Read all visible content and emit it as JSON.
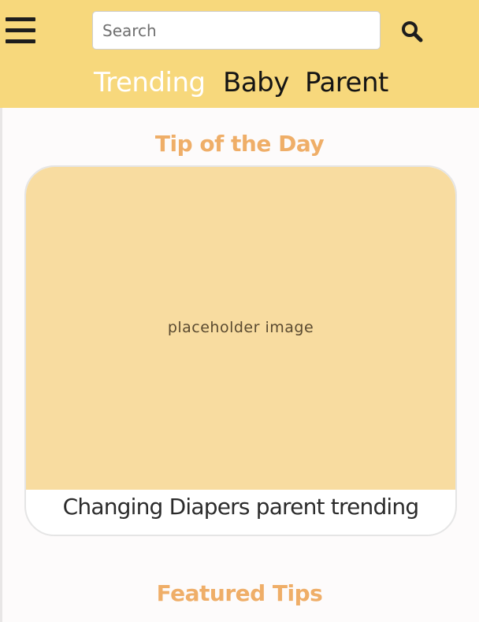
{
  "header": {
    "menu_icon": "hamburger-menu-icon",
    "search": {
      "placeholder": "Search",
      "value": ""
    },
    "search_icon": "magnifying-glass-icon",
    "tabs": [
      {
        "label": "Trending",
        "active": true
      },
      {
        "label": "Baby",
        "active": false
      },
      {
        "label": "Parent",
        "active": false
      }
    ]
  },
  "main": {
    "tip_of_the_day": {
      "title": "Tip of the Day",
      "card": {
        "image_label": "placeholder image",
        "caption": "Changing Diapers parent trending"
      }
    },
    "featured_tips": {
      "title": "Featured Tips"
    }
  },
  "colors": {
    "header_bg": "#f7d87c",
    "accent_orange": "#efae68",
    "image_placeholder_bg": "#f8dca0",
    "active_tab_text": "#ffffff",
    "text_dark": "#141414"
  }
}
